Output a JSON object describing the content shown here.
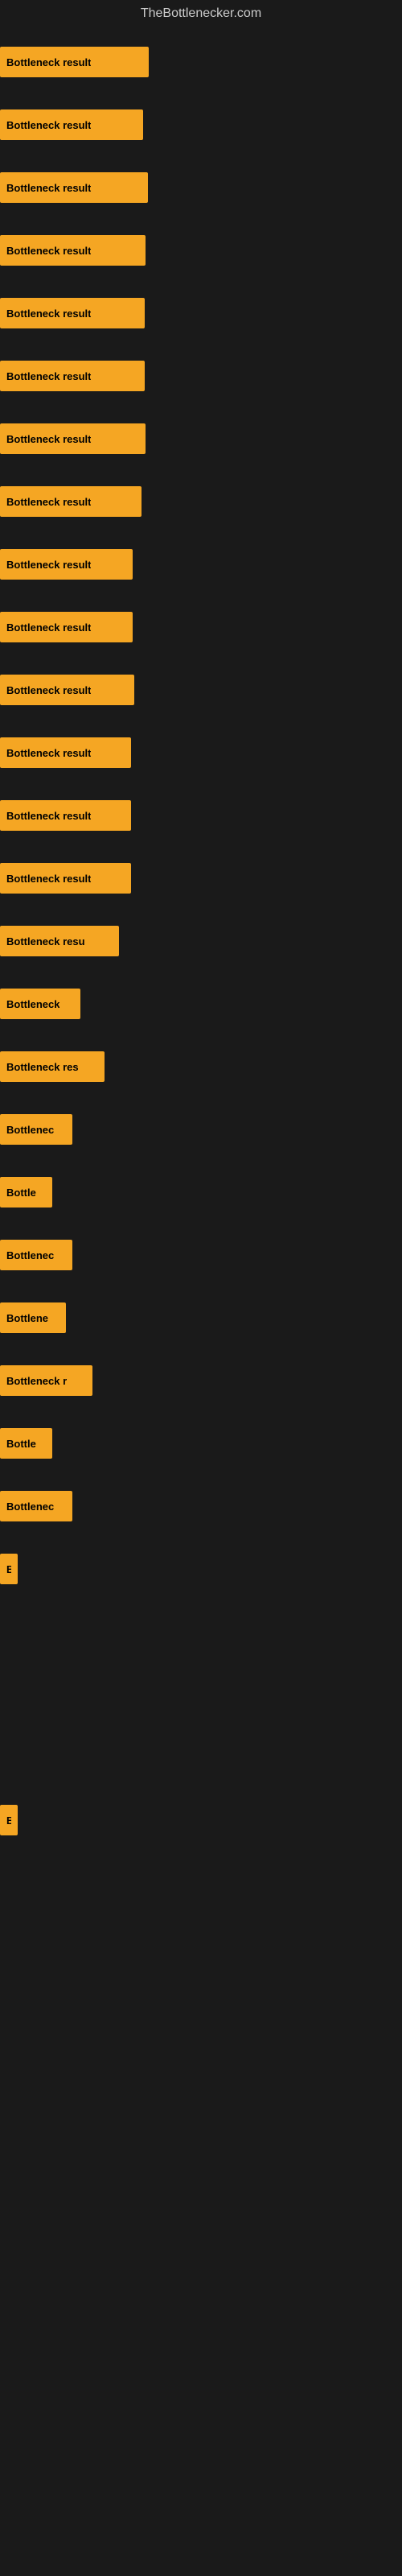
{
  "site": {
    "title": "TheBottlenecker.com"
  },
  "bars": [
    {
      "id": 1,
      "label": "Bottleneck result",
      "width": 185
    },
    {
      "id": 2,
      "label": "Bottleneck result",
      "width": 178
    },
    {
      "id": 3,
      "label": "Bottleneck result",
      "width": 184
    },
    {
      "id": 4,
      "label": "Bottleneck result",
      "width": 181
    },
    {
      "id": 5,
      "label": "Bottleneck result",
      "width": 180
    },
    {
      "id": 6,
      "label": "Bottleneck result",
      "width": 180
    },
    {
      "id": 7,
      "label": "Bottleneck result",
      "width": 181
    },
    {
      "id": 8,
      "label": "Bottleneck result",
      "width": 176
    },
    {
      "id": 9,
      "label": "Bottleneck result",
      "width": 165
    },
    {
      "id": 10,
      "label": "Bottleneck result",
      "width": 165
    },
    {
      "id": 11,
      "label": "Bottleneck result",
      "width": 167
    },
    {
      "id": 12,
      "label": "Bottleneck result",
      "width": 163
    },
    {
      "id": 13,
      "label": "Bottleneck result",
      "width": 163
    },
    {
      "id": 14,
      "label": "Bottleneck result",
      "width": 163
    },
    {
      "id": 15,
      "label": "Bottleneck resu",
      "width": 148
    },
    {
      "id": 16,
      "label": "Bottleneck",
      "width": 100
    },
    {
      "id": 17,
      "label": "Bottleneck res",
      "width": 130
    },
    {
      "id": 18,
      "label": "Bottlenec",
      "width": 90
    },
    {
      "id": 19,
      "label": "Bottle",
      "width": 65
    },
    {
      "id": 20,
      "label": "Bottlenec",
      "width": 90
    },
    {
      "id": 21,
      "label": "Bottlene",
      "width": 82
    },
    {
      "id": 22,
      "label": "Bottleneck r",
      "width": 115
    },
    {
      "id": 23,
      "label": "Bottle",
      "width": 65
    },
    {
      "id": 24,
      "label": "Bottlenec",
      "width": 90
    },
    {
      "id": 25,
      "label": "B",
      "width": 22
    },
    {
      "id": 26,
      "label": "",
      "width": 0
    },
    {
      "id": 27,
      "label": "",
      "width": 0
    },
    {
      "id": 28,
      "label": "",
      "width": 0
    },
    {
      "id": 29,
      "label": "B",
      "width": 22
    },
    {
      "id": 30,
      "label": "",
      "width": 0
    },
    {
      "id": 31,
      "label": "",
      "width": 0
    },
    {
      "id": 32,
      "label": "",
      "width": 0
    },
    {
      "id": 33,
      "label": "",
      "width": 0
    },
    {
      "id": 34,
      "label": "",
      "width": 0
    },
    {
      "id": 35,
      "label": "",
      "width": 0
    },
    {
      "id": 36,
      "label": "",
      "width": 0
    }
  ]
}
